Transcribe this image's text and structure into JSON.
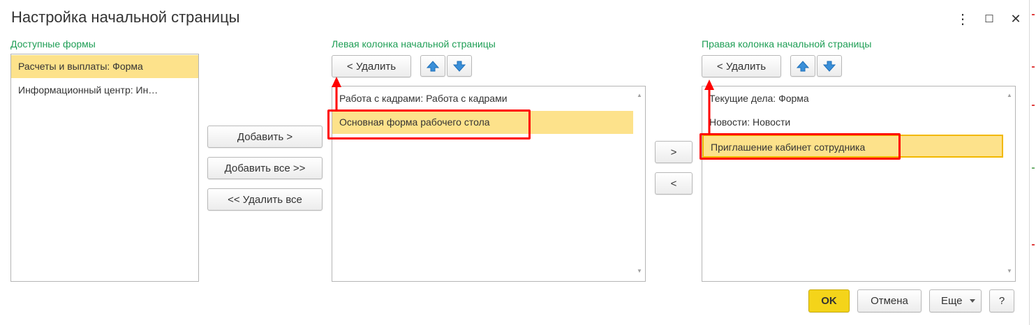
{
  "window": {
    "title": "Настройка начальной страницы",
    "more_icon": "⋮",
    "maximize_icon": "☐",
    "close_icon": "✕"
  },
  "available": {
    "label": "Доступные формы",
    "items": [
      "Расчеты и выплаты: Форма",
      "Информационный центр: Ин…"
    ],
    "selected_index": 0
  },
  "middle_buttons": {
    "add": "Добавить >",
    "add_all": "Добавить все >>",
    "remove_all": "<< Удалить все"
  },
  "left_column": {
    "label": "Левая колонка начальной страницы",
    "remove": "< Удалить",
    "items": [
      "Работа с кадрами: Работа с кадрами",
      "Основная форма рабочего стола"
    ],
    "selected_index": 1
  },
  "move_buttons": {
    "right": ">",
    "left": "<"
  },
  "right_column": {
    "label": "Правая колонка начальной страницы",
    "remove": "< Удалить",
    "items": [
      "Текущие дела: Форма",
      "Новости: Новости",
      "Приглашение кабинет сотрудника"
    ],
    "selected_index": 2
  },
  "footer": {
    "ok": "OK",
    "cancel": "Отмена",
    "more": "Еще",
    "help": "?"
  },
  "colors": {
    "accent_label": "#1e9e55",
    "selection": "#fde28b",
    "annotation": "#ff0000",
    "ok_button": "#f4d41a",
    "arrow_icon": "#3a8fd8"
  },
  "icons": {
    "up": "arrow-up-icon",
    "down": "arrow-down-icon",
    "dropdown": "caret-down-icon",
    "scroll_up": "▲",
    "scroll_down": "▼"
  }
}
